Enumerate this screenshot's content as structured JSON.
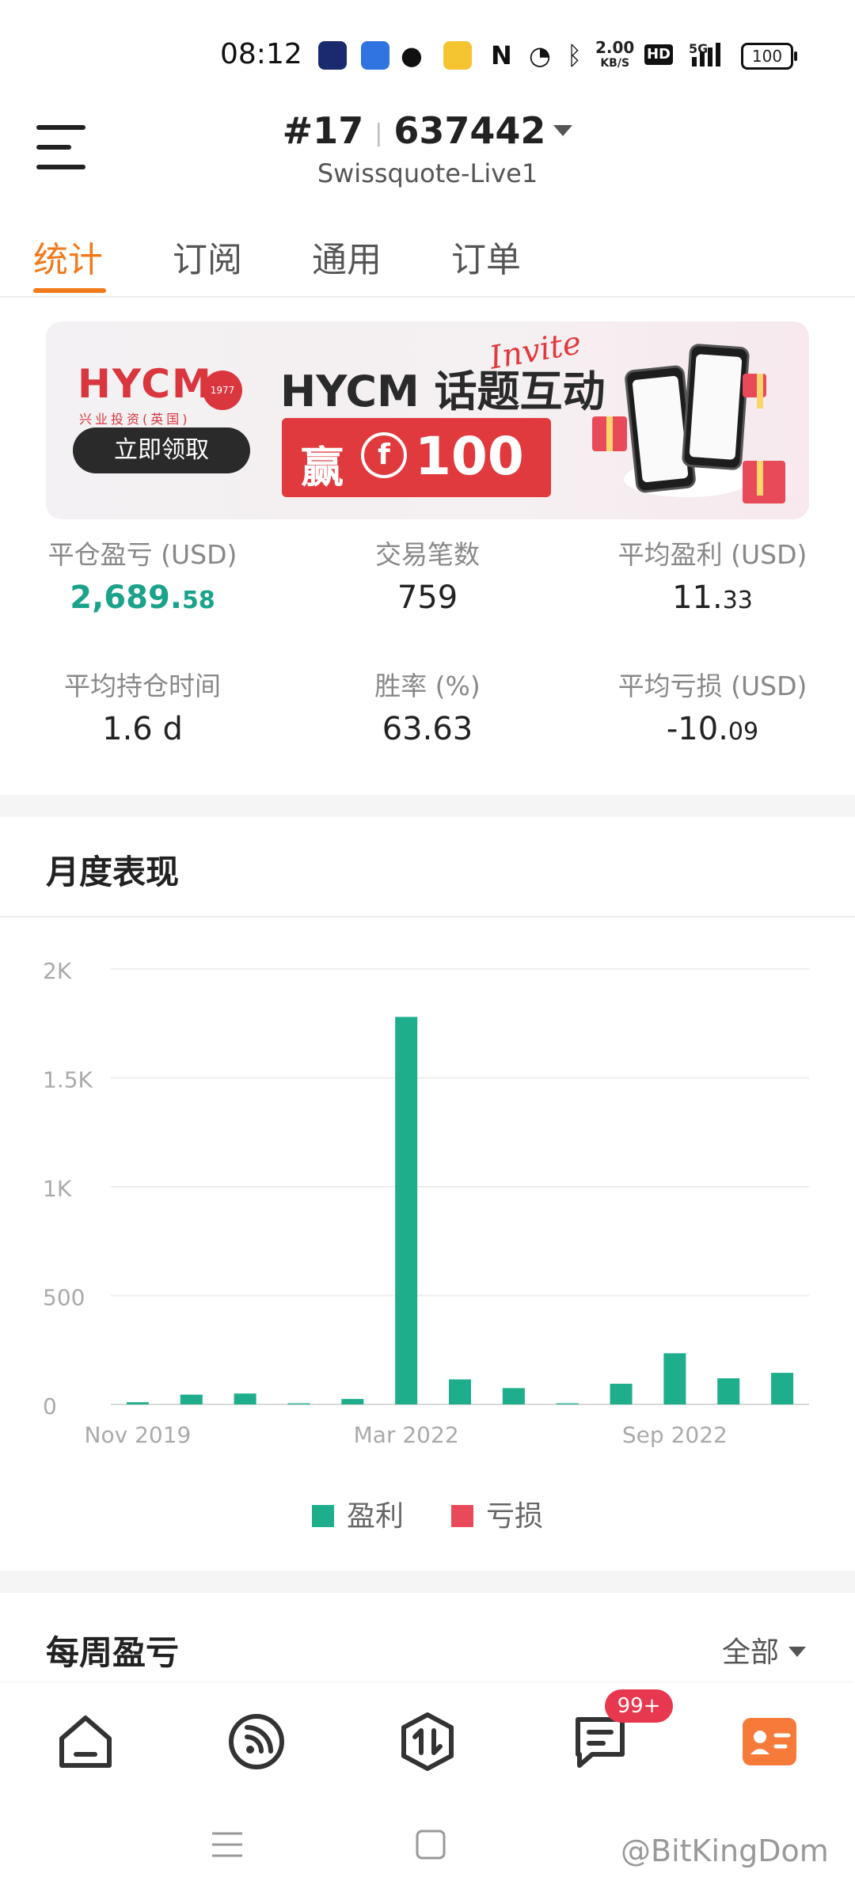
{
  "status_bar": {
    "time": "08:12",
    "net_speed_top": "2.00",
    "net_speed_bottom": "KB/S",
    "hd": "HD",
    "signal": "5G",
    "battery": "100",
    "icons": [
      "app-icon-1",
      "app-icon-2",
      "wechat-icon",
      "mail-icon",
      "nfc-icon",
      "alarm-icon",
      "bluetooth-icon",
      "signal-icon",
      "battery-icon"
    ]
  },
  "header": {
    "account_prefix": "#17",
    "account_number": "637442",
    "server": "Swissquote-Live1"
  },
  "tabs": [
    {
      "label": "统计",
      "active": true
    },
    {
      "label": "订阅",
      "active": false
    },
    {
      "label": "通用",
      "active": false
    },
    {
      "label": "订单",
      "active": false
    }
  ],
  "banner": {
    "logo": "HYCM",
    "logo_year": "1977",
    "logo_sub": "兴业投资(英国)",
    "title": "HYCM 话题互动",
    "invite": "Invite",
    "prize_prefix": "赢",
    "prize_coin": "f",
    "prize_amount": "100",
    "cta": "立即领取"
  },
  "stats": {
    "row1": [
      {
        "label": "平仓盈亏 (USD)",
        "value_main": "2,689.",
        "value_dec": "58",
        "green": true
      },
      {
        "label": "交易笔数",
        "value_main": "759",
        "value_dec": ""
      },
      {
        "label": "平均盈利 (USD)",
        "value_main": "11.",
        "value_dec": "33"
      }
    ],
    "row2": [
      {
        "label": "平均持仓时间",
        "value_main": "1.6 d",
        "value_dec": ""
      },
      {
        "label": "胜率 (%)",
        "value_main": "63.63",
        "value_dec": ""
      },
      {
        "label": "平均亏损 (USD)",
        "value_main": "-10.",
        "value_dec": "09"
      }
    ]
  },
  "monthly": {
    "title": "月度表现",
    "legend": [
      {
        "label": "盈利",
        "color": "#1fae8c"
      },
      {
        "label": "亏损",
        "color": "#e84a5a"
      }
    ]
  },
  "chart_data": {
    "type": "bar",
    "title": "月度表现",
    "y_ticks": [
      "2K",
      "1.5K",
      "1K",
      "500",
      "0"
    ],
    "ylim": [
      0,
      2000
    ],
    "x_tick_labels": [
      "Nov 2019",
      "Mar 2022",
      "Sep 2022"
    ],
    "x_tick_positions": [
      0,
      5,
      10
    ],
    "series": [
      {
        "name": "盈利",
        "color": "#1fae8c",
        "values": [
          10,
          45,
          50,
          5,
          25,
          1780,
          115,
          75,
          5,
          95,
          235,
          120,
          145
        ]
      },
      {
        "name": "亏损",
        "color": "#e84a5a",
        "values": [
          0,
          0,
          0,
          0,
          0,
          0,
          0,
          0,
          0,
          0,
          0,
          0,
          0
        ]
      }
    ],
    "grid": true,
    "legend_position": "bottom"
  },
  "weekly": {
    "title": "每周盈亏",
    "filter": "全部"
  },
  "bottom_nav": {
    "items": [
      "home-icon",
      "feed-icon",
      "trade-icon",
      "messages-icon",
      "profile-icon"
    ],
    "badge": "99+"
  },
  "system_nav": {
    "watermark": "@BitKingDom"
  }
}
